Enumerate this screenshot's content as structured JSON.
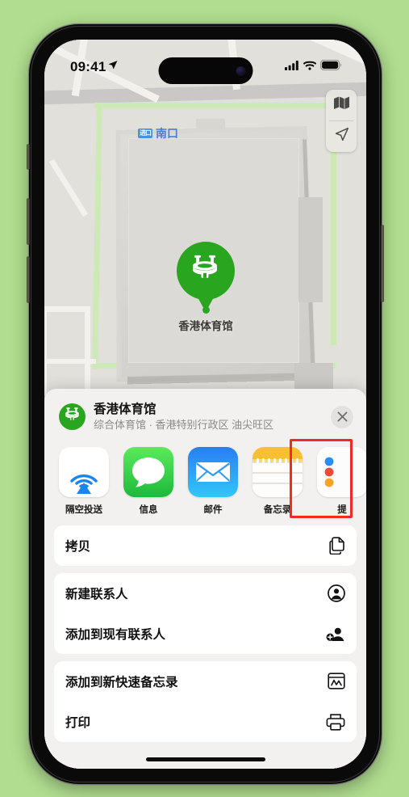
{
  "background_color": "#b0dd8f",
  "status_bar": {
    "time": "09:41",
    "location_arrow_icon": "location-arrow-icon",
    "signal_icon": "cellular-signal-icon",
    "wifi_icon": "wifi-icon",
    "battery_icon": "battery-full-icon"
  },
  "map": {
    "transit_badge": "进口",
    "transit_name": "南口",
    "pin_label": "香港体育馆",
    "pin_icon": "stadium-icon",
    "pin_color": "#2aa520",
    "controls": [
      {
        "name": "map-layers-button",
        "icon": "map-icon"
      },
      {
        "name": "current-location-button",
        "icon": "location-arrow-icon"
      }
    ]
  },
  "share_sheet": {
    "title": "香港体育馆",
    "subtitle": "综合体育馆 · 香港特别行政区 油尖旺区",
    "avatar_icon": "stadium-icon",
    "close_label": "✕",
    "apps": [
      {
        "label": "隔空投送",
        "icon": "airdrop-icon",
        "highlighted": false
      },
      {
        "label": "信息",
        "icon": "messages-icon",
        "highlighted": false
      },
      {
        "label": "邮件",
        "icon": "mail-icon",
        "highlighted": false
      },
      {
        "label": "备忘录",
        "icon": "notes-icon",
        "highlighted": true
      },
      {
        "label": "提",
        "icon": "reminders-icon",
        "highlighted": false
      }
    ],
    "highlight_color": "#ef2b24",
    "actions": [
      {
        "label": "拷贝",
        "icon": "copy-icon"
      },
      {
        "label": "新建联系人",
        "icon": "new-contact-icon"
      },
      {
        "label": "添加到现有联系人",
        "icon": "add-to-contact-icon"
      },
      {
        "label": "添加到新快速备忘录",
        "icon": "quick-note-icon"
      },
      {
        "label": "打印",
        "icon": "printer-icon"
      }
    ]
  }
}
